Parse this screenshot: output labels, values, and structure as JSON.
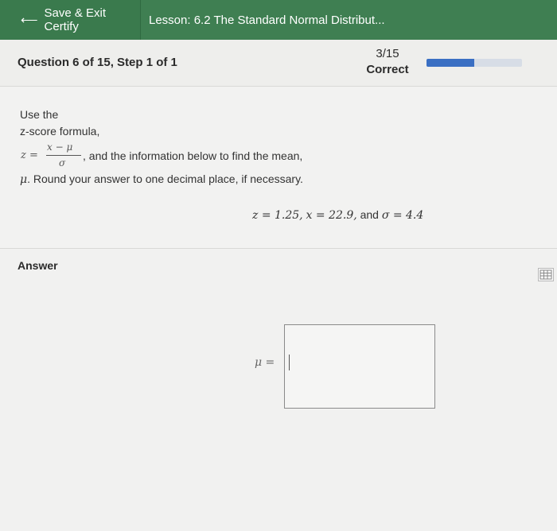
{
  "topbar": {
    "exit_label": "Save & Exit Certify",
    "lesson_title": "Lesson: 6.2 The Standard Normal Distribut..."
  },
  "question_header": {
    "label": "Question 6 of 15, Step 1 of 1",
    "score_fraction": "3/15",
    "score_label": "Correct",
    "progress_fraction": 0.5
  },
  "question": {
    "line1": "Use the",
    "line2": "z-score formula,",
    "formula_lhs": "z =",
    "formula_numerator": "x − μ",
    "formula_denominator": "σ",
    "line3_after_formula": ", and the information below to find the mean,",
    "line4_mu": "μ",
    "line4_rest": ". Round your answer to one decimal place, if necessary.",
    "given_z": "z = 1.25,",
    "given_x": "x = 22.9,",
    "given_and": "and",
    "given_sigma": "σ = 4.4"
  },
  "answer": {
    "label": "Answer",
    "mu_label": "μ =",
    "value": ""
  },
  "colors": {
    "topbar": "#3f7f52",
    "progress_fill": "#3a6fc3",
    "progress_track": "#d7dde6"
  }
}
